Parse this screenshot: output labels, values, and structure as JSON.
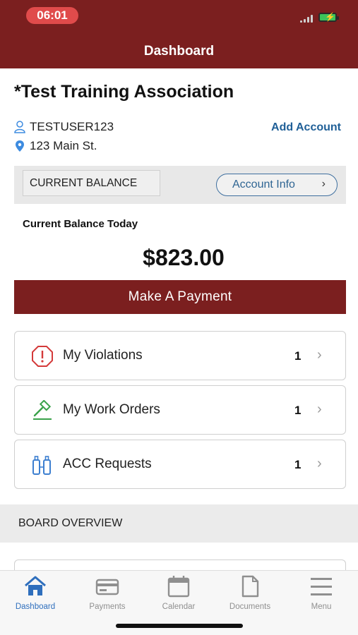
{
  "status_bar": {
    "time": "06:01"
  },
  "header": {
    "title": "Dashboard"
  },
  "account": {
    "association_name": "*Test Training Association",
    "username": "TESTUSER123",
    "address": "123 Main St.",
    "add_account_label": "Add Account"
  },
  "balance": {
    "tab_label": "CURRENT BALANCE",
    "account_info_label": "Account Info",
    "today_label": "Current Balance Today",
    "amount": "$823.00",
    "pay_button_label": "Make A Payment"
  },
  "cards": [
    {
      "label": "My Violations",
      "count": "1",
      "icon": "alert-octagon-icon"
    },
    {
      "label": "My Work Orders",
      "count": "1",
      "icon": "hammer-icon"
    },
    {
      "label": "ACC Requests",
      "count": "1",
      "icon": "paint-tubes-icon"
    }
  ],
  "board": {
    "title": "BOARD OVERVIEW"
  },
  "tabbar": [
    {
      "label": "Dashboard",
      "icon": "home-icon",
      "active": true
    },
    {
      "label": "Payments",
      "icon": "credit-card-icon",
      "active": false
    },
    {
      "label": "Calendar",
      "icon": "calendar-icon",
      "active": false
    },
    {
      "label": "Documents",
      "icon": "document-icon",
      "active": false
    },
    {
      "label": "Menu",
      "icon": "menu-icon",
      "active": false
    }
  ],
  "colors": {
    "brand": "#7b1f1f",
    "link": "#1f5f97",
    "active_tab": "#2f6fbd"
  }
}
